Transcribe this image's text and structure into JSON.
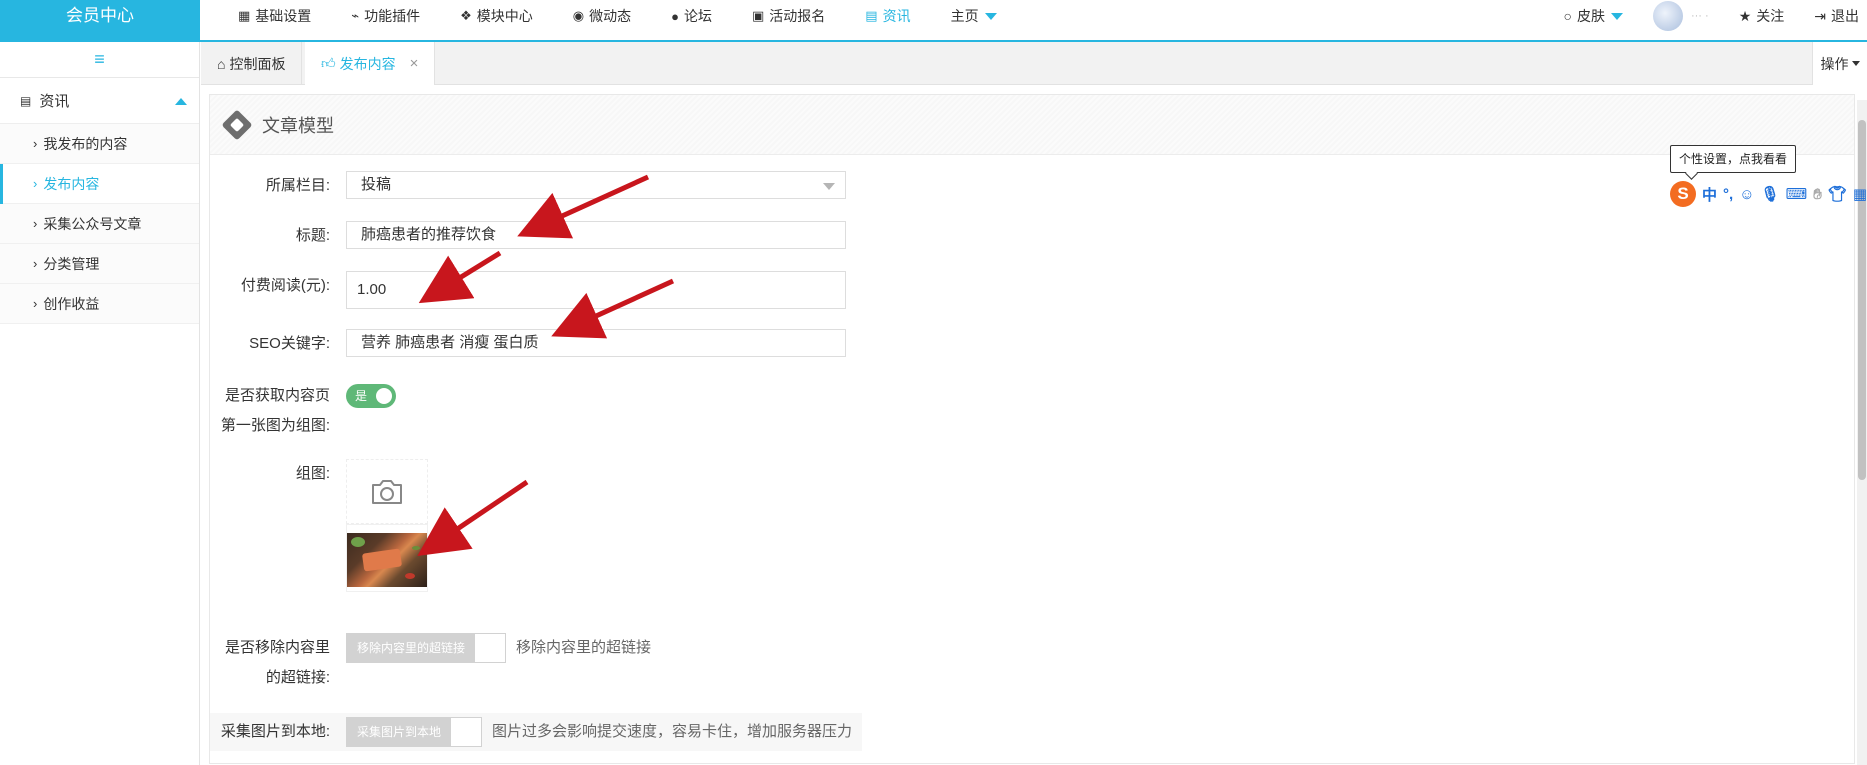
{
  "brand": "会员中心",
  "nav": [
    {
      "icon": "grid",
      "label": "基础设置"
    },
    {
      "icon": "plug",
      "label": "功能插件"
    },
    {
      "icon": "cubes",
      "label": "模块中心"
    },
    {
      "icon": "weibo",
      "label": "微动态"
    },
    {
      "icon": "comment",
      "label": "论坛"
    },
    {
      "icon": "calendar",
      "label": "活动报名"
    },
    {
      "icon": "document",
      "label": "资讯",
      "active": true
    },
    {
      "icon": "",
      "label": "主页",
      "dropdown": true
    }
  ],
  "right": {
    "skin": "皮肤",
    "follow": "关注",
    "logout": "退出"
  },
  "sidebar": {
    "group": "资讯",
    "items": [
      "我发布的内容",
      "发布内容",
      "采集公众号文章",
      "分类管理",
      "创作收益"
    ],
    "active_index": 1
  },
  "tabs": {
    "items": [
      {
        "label": "控制面板"
      },
      {
        "label": "发布内容",
        "active": true
      }
    ],
    "operation": "操作"
  },
  "panel": {
    "title": "文章模型"
  },
  "form": {
    "category_label": "所属栏目:",
    "category_value": "投稿",
    "title_label": "标题:",
    "title_value": "肺癌患者的推荐饮食",
    "price_label": "付费阅读(元):",
    "price_value": "1.00",
    "seo_label": "SEO关键字:",
    "seo_value": "营养 肺癌患者 消瘦 蛋白质",
    "first_image_label_1": "是否获取内容页",
    "first_image_label_2": "第一张图为组图:",
    "first_image_switch": "是",
    "gallery_label": "组图:",
    "remove_links_label_1": "是否移除内容里",
    "remove_links_label_2": "的超链接:",
    "remove_links_btn": "移除内容里的超链接",
    "remove_links_hint": "移除内容里的超链接",
    "collect_images_label": "采集图片到本地:",
    "collect_images_btn": "采集图片到本地",
    "collect_images_hint": "图片过多会影响提交速度，容易卡住，增加服务器压力"
  },
  "ime": {
    "tooltip": "个性设置，点我看看",
    "logo": "S",
    "lang": "中"
  },
  "colors": {
    "accent": "#27b6e0",
    "switch_on": "#5fb878",
    "arrow": "#c8161d"
  }
}
